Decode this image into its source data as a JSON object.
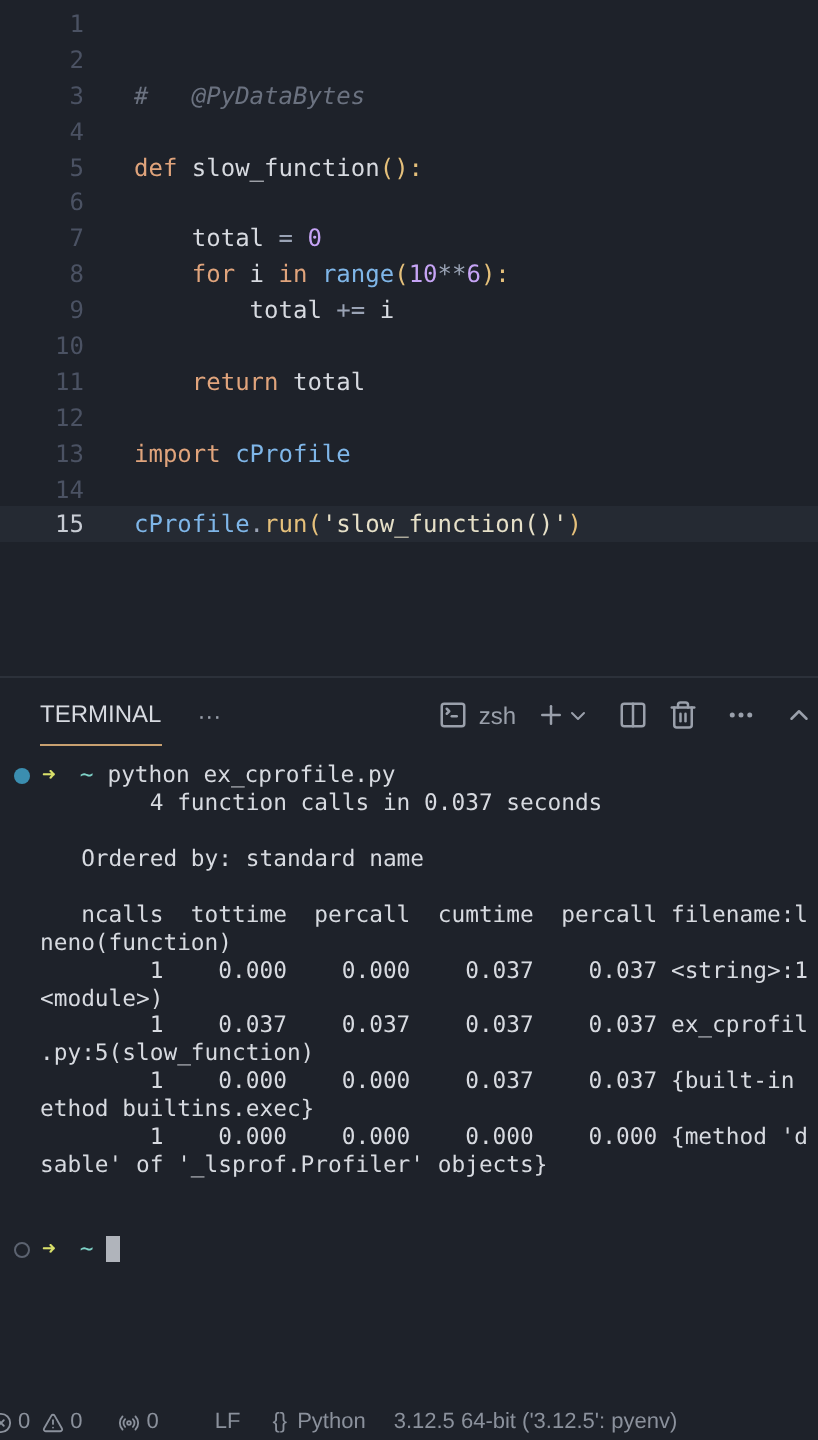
{
  "editor": {
    "lines": [
      {
        "number": "1",
        "selected": false
      },
      {
        "number": "2",
        "selected": false
      },
      {
        "number": "3",
        "selected": false,
        "tokens": [
          {
            "text": "#   @PyDataBytes",
            "kind": "comment"
          }
        ]
      },
      {
        "number": "4",
        "selected": false
      },
      {
        "number": "5",
        "selected": false,
        "tokens": [
          {
            "text": "def",
            "kind": "keyword"
          },
          {
            "text": " slow_function",
            "kind": "plain"
          },
          {
            "text": "():",
            "kind": "punct"
          }
        ]
      },
      {
        "number": "6",
        "selected": false
      },
      {
        "number": "7",
        "selected": false,
        "tokens": [
          {
            "text": "    total",
            "kind": "plain"
          },
          {
            "text": " = ",
            "kind": "op"
          },
          {
            "text": "0",
            "kind": "number"
          }
        ]
      },
      {
        "number": "8",
        "selected": false,
        "tokens": [
          {
            "text": "    for",
            "kind": "keyword"
          },
          {
            "text": " i ",
            "kind": "plain"
          },
          {
            "text": "in",
            "kind": "keyword"
          },
          {
            "text": " range",
            "kind": "builtin"
          },
          {
            "text": "(",
            "kind": "punct"
          },
          {
            "text": "10",
            "kind": "number"
          },
          {
            "text": "**",
            "kind": "op"
          },
          {
            "text": "6",
            "kind": "number"
          },
          {
            "text": "):",
            "kind": "punct"
          }
        ]
      },
      {
        "number": "9",
        "selected": false,
        "tokens": [
          {
            "text": "        total",
            "kind": "plain"
          },
          {
            "text": " += ",
            "kind": "op"
          },
          {
            "text": "i",
            "kind": "plain"
          }
        ]
      },
      {
        "number": "10",
        "selected": false
      },
      {
        "number": "11",
        "selected": false,
        "tokens": [
          {
            "text": "    return",
            "kind": "keyword"
          },
          {
            "text": " total",
            "kind": "plain"
          }
        ]
      },
      {
        "number": "12",
        "selected": false
      },
      {
        "number": "13",
        "selected": false,
        "tokens": [
          {
            "text": "import",
            "kind": "keyword"
          },
          {
            "text": " cProfile",
            "kind": "builtin"
          }
        ]
      },
      {
        "number": "14",
        "selected": false
      },
      {
        "number": "15",
        "selected": true,
        "tokens": [
          {
            "text": "cProfile",
            "kind": "builtin"
          },
          {
            "text": ".",
            "kind": "op"
          },
          {
            "text": "run",
            "kind": "method"
          },
          {
            "text": "(",
            "kind": "punct"
          },
          {
            "text": "'slow_function()'",
            "kind": "string"
          },
          {
            "text": ")",
            "kind": "punct"
          }
        ]
      }
    ]
  },
  "panel": {
    "tabs": [
      {
        "label": "TERMINAL",
        "selected": true
      }
    ],
    "more": "···",
    "shell": "zsh"
  },
  "terminal": {
    "lines": [
      {
        "kind": "prompt",
        "finished": true,
        "arrow": "➜",
        "cwd": "~",
        "command": "python ex_cprofile.py"
      },
      {
        "kind": "output",
        "text": "        4 function calls in 0.037 seconds"
      },
      {
        "kind": "blank"
      },
      {
        "kind": "output",
        "text": "   Ordered by: standard name"
      },
      {
        "kind": "blank"
      },
      {
        "kind": "output",
        "text": "   ncalls  tottime  percall  cumtime  percall filename:l"
      },
      {
        "kind": "output",
        "text": "neno(function)"
      },
      {
        "kind": "output",
        "text": "        1    0.000    0.000    0.037    0.037 <string>:1"
      },
      {
        "kind": "output",
        "text": "<module>)"
      },
      {
        "kind": "output",
        "text": "        1    0.037    0.037    0.037    0.037 ex_cprofil"
      },
      {
        "kind": "output",
        "text": ".py:5(slow_function)"
      },
      {
        "kind": "output",
        "text": "        1    0.000    0.000    0.037    0.037 {built-in"
      },
      {
        "kind": "output",
        "text": "ethod builtins.exec}"
      },
      {
        "kind": "output",
        "text": "        1    0.000    0.000    0.000    0.000 {method 'd"
      },
      {
        "kind": "output",
        "text": "sable' of '_lsprof.Profiler' objects}"
      },
      {
        "kind": "blank"
      },
      {
        "kind": "blank"
      },
      {
        "kind": "prompt",
        "finished": false,
        "arrow": "➜",
        "cwd": "~",
        "cursor": true
      }
    ]
  },
  "status_bar": {
    "errors": "0",
    "warnings": "0",
    "ports": "0",
    "eol": "LF",
    "language_icon": "{}",
    "language": "Python",
    "interpreter": "3.12.5 64-bit ('3.12.5': pyenv)"
  }
}
